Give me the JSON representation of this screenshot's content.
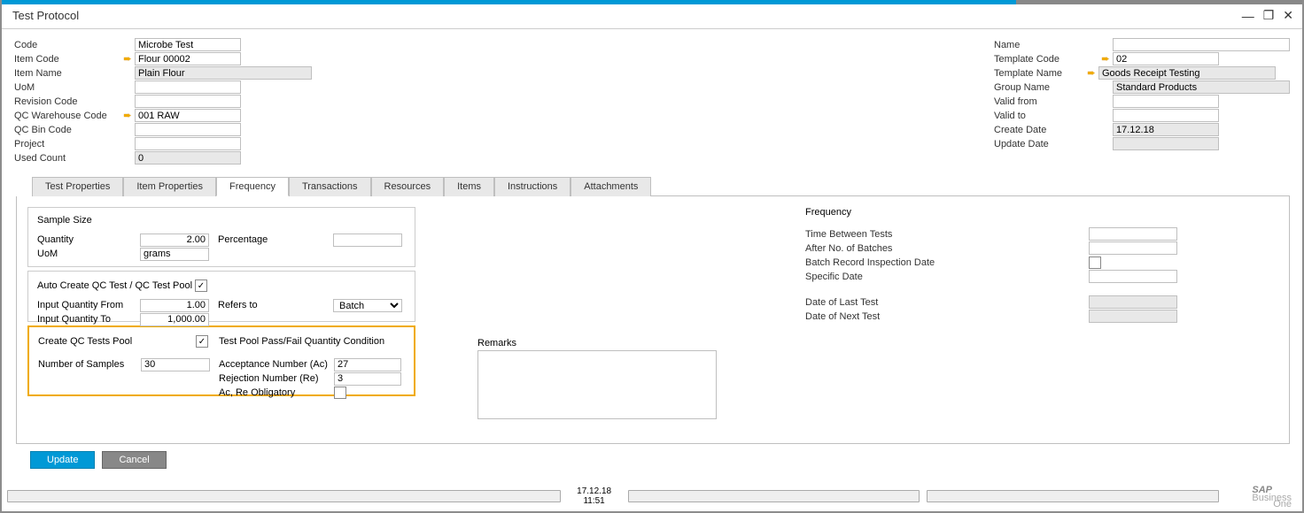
{
  "window": {
    "title": "Test Protocol"
  },
  "left": {
    "code_lbl": "Code",
    "code": "Microbe Test",
    "item_code_lbl": "Item Code",
    "item_code": "Flour 00002",
    "item_name_lbl": "Item Name",
    "item_name": "Plain Flour",
    "uom_lbl": "UoM",
    "uom": "",
    "rev_lbl": "Revision Code",
    "rev": "",
    "qcwh_lbl": "QC Warehouse Code",
    "qcwh": "001 RAW",
    "qcbin_lbl": "QC Bin Code",
    "qcbin": "",
    "project_lbl": "Project",
    "project": "",
    "used_lbl": "Used Count",
    "used": "0"
  },
  "right": {
    "name_lbl": "Name",
    "name": "",
    "tcode_lbl": "Template Code",
    "tcode": "02",
    "tname_lbl": "Template Name",
    "tname": "Goods Receipt Testing",
    "group_lbl": "Group Name",
    "group": "Standard Products",
    "vfrom_lbl": "Valid from",
    "vfrom": "",
    "vto_lbl": "Valid to",
    "vto": "",
    "cdate_lbl": "Create Date",
    "cdate": "17.12.18",
    "udate_lbl": "Update Date",
    "udate": ""
  },
  "tabs": [
    "Test Properties",
    "Item Properties",
    "Frequency",
    "Transactions",
    "Resources",
    "Items",
    "Instructions",
    "Attachments"
  ],
  "sample": {
    "title": "Sample Size",
    "qty_lbl": "Quantity",
    "qty": "2.00",
    "uom_lbl": "UoM",
    "uom": "grams",
    "pct_lbl": "Percentage",
    "pct": ""
  },
  "auto": {
    "title": "Auto Create QC Test / QC Test Pool",
    "chk": "✓",
    "from_lbl": "Input Quantity From",
    "from": "1.00",
    "to_lbl": "Input Quantity To",
    "to": "1,000.00",
    "refers_lbl": "Refers to",
    "refers": "Batch"
  },
  "pool": {
    "title": "Create QC Tests Pool",
    "chk": "✓",
    "cond_title": "Test Pool Pass/Fail Quantity Condition",
    "num_lbl": "Number of Samples",
    "num": "30",
    "ac_lbl": "Acceptance Number (Ac)",
    "ac": "27",
    "re_lbl": "Rejection Number (Re)",
    "re": "3",
    "oblig_lbl": "Ac, Re Obligatory",
    "oblig": ""
  },
  "remarks_lbl": "Remarks",
  "freq": {
    "title": "Frequency",
    "tbt_lbl": "Time Between Tests",
    "tbt": "",
    "anb_lbl": "After No. of Batches",
    "anb": "",
    "brid_lbl": "Batch Record Inspection Date",
    "brid": "",
    "sd_lbl": "Specific Date",
    "sd": "",
    "dlt_lbl": "Date of Last Test",
    "dlt": "",
    "dnt_lbl": "Date of Next Test",
    "dnt": ""
  },
  "buttons": {
    "update": "Update",
    "cancel": "Cancel"
  },
  "status": {
    "date": "17.12.18",
    "time": "11:51"
  },
  "logo": {
    "main": "SAP",
    "sub1": "Business",
    "sub2": "One"
  }
}
